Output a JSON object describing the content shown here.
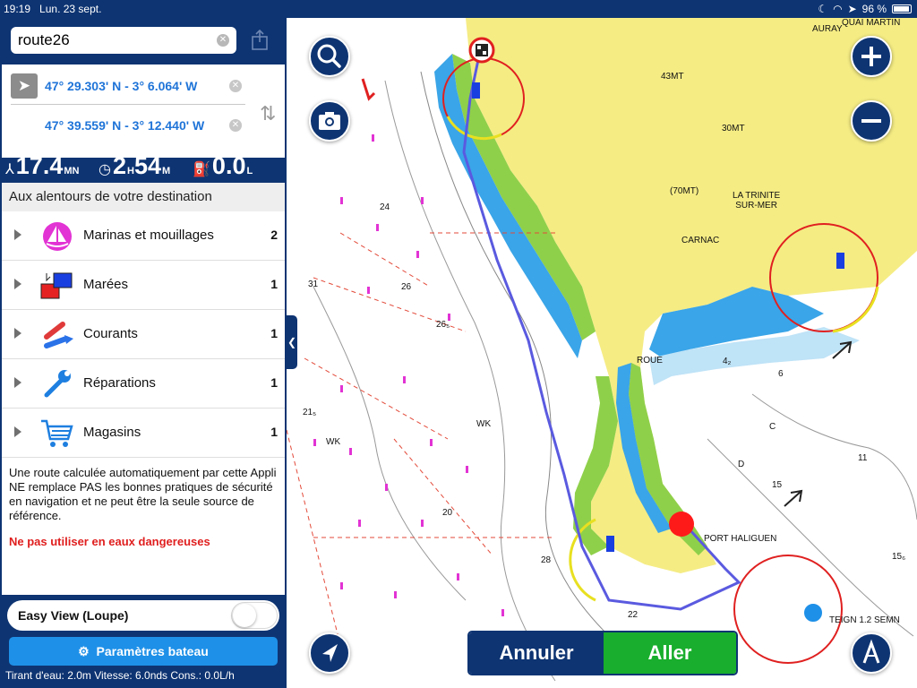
{
  "status_bar": {
    "time": "19:19",
    "date": "Lun. 23 sept.",
    "battery": "96 %"
  },
  "route": {
    "name": "route26",
    "start_coord": "47° 29.303' N - 3° 6.064' W",
    "end_coord": "47° 39.559' N - 3° 12.440' W"
  },
  "stats": {
    "distance_value": "17.4",
    "distance_unit": "MN",
    "duration_hours": "2",
    "duration_h_unit": "H",
    "duration_minutes": "54",
    "duration_m_unit": "M",
    "fuel_value": "0.0",
    "fuel_unit": "L"
  },
  "around": {
    "header": "Aux alentours de votre destination",
    "items": [
      {
        "label": "Marinas et mouillages",
        "count": "2",
        "icon": "marina-icon"
      },
      {
        "label": "Marées",
        "count": "1",
        "icon": "tide-icon"
      },
      {
        "label": "Courants",
        "count": "1",
        "icon": "current-icon"
      },
      {
        "label": "Réparations",
        "count": "1",
        "icon": "wrench-icon"
      },
      {
        "label": "Magasins",
        "count": "1",
        "icon": "cart-icon"
      }
    ]
  },
  "disclaimer": "Une route calculée automatiquement par cette Appli NE remplace PAS les bonnes pratiques de sécurité en navigation et ne peut être la seule source de référence.",
  "warning": "Ne pas utiliser en eaux dangereuses",
  "easy_view": {
    "label": "Easy View (Loupe)",
    "enabled": false
  },
  "boat_params_button": "Paramètres bateau",
  "boat_summary": "Tirant d'eau: 2.0m Vitesse: 6.0nds Cons.: 0.0L/h",
  "map": {
    "labels": {
      "carnac": "CARNAC",
      "trinite": "LA TRINITE\nSUR-MER",
      "port_haliguen": "PORT HALIGUEN",
      "auray": "AURAY",
      "quai": "QUAI MARTIN",
      "mt43": "43MT",
      "mt30": "30MT",
      "mt70": "(70MT)",
      "roue": "ROUE",
      "wk1": "WK",
      "wk2": "WK",
      "d_mark": "D",
      "c_mark": "C",
      "teign": "TEIGN 1.2 SEMN",
      "d24": "24",
      "d26": "26",
      "d265": "26₅",
      "d31": "31",
      "d215": "21₅",
      "d28": "28",
      "d22": "22",
      "d20": "20",
      "d15": "15",
      "d6": "6",
      "d42": "4₂",
      "d11": "11",
      "d156": "15₆"
    }
  },
  "actions": {
    "cancel": "Annuler",
    "go": "Aller"
  },
  "colors": {
    "navy": "#0e3472",
    "accent_blue": "#1e90e8",
    "go_green": "#19ae2d",
    "warning_red": "#e01e1e",
    "land_yellow": "#f5ec84",
    "shallow_blue": "#3aa5e8",
    "route": "#5a5ae0"
  }
}
